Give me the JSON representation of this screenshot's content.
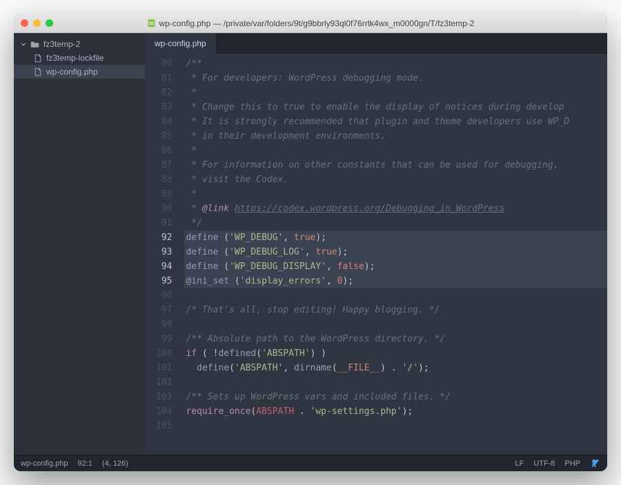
{
  "window": {
    "title": "wp-config.php — /private/var/folders/9t/g9bbrly93ql0f76rrtk4wx_m0000gn/T/fz3temp-2"
  },
  "sidebar": {
    "folder": "fz3temp-2",
    "files": [
      {
        "name": "fz3temp-lockfile",
        "active": false
      },
      {
        "name": "wp-config.php",
        "active": true
      }
    ]
  },
  "tabs": [
    {
      "label": "wp-config.php",
      "active": true
    }
  ],
  "editor": {
    "lines": [
      {
        "n": 80,
        "hl": false,
        "tokens": [
          [
            "c-comment",
            "/**"
          ]
        ]
      },
      {
        "n": 81,
        "hl": false,
        "tokens": [
          [
            "c-comment",
            " * For developers: WordPress debugging mode."
          ]
        ]
      },
      {
        "n": 82,
        "hl": false,
        "tokens": [
          [
            "c-comment",
            " *"
          ]
        ]
      },
      {
        "n": 83,
        "hl": false,
        "tokens": [
          [
            "c-comment",
            " * Change this to true to enable the display of notices during develop"
          ]
        ]
      },
      {
        "n": 84,
        "hl": false,
        "tokens": [
          [
            "c-comment",
            " * It is strongly recommended that plugin and theme developers use WP_D"
          ]
        ]
      },
      {
        "n": 85,
        "hl": false,
        "tokens": [
          [
            "c-comment",
            " * in their development environments."
          ]
        ]
      },
      {
        "n": 86,
        "hl": false,
        "tokens": [
          [
            "c-comment",
            " *"
          ]
        ]
      },
      {
        "n": 87,
        "hl": false,
        "tokens": [
          [
            "c-comment",
            " * For information on other constants that can be used for debugging,"
          ]
        ]
      },
      {
        "n": 88,
        "hl": false,
        "tokens": [
          [
            "c-comment",
            " * visit the Codex."
          ]
        ]
      },
      {
        "n": 89,
        "hl": false,
        "tokens": [
          [
            "c-comment",
            " *"
          ]
        ]
      },
      {
        "n": 90,
        "hl": false,
        "tokens": [
          [
            "c-comment",
            " * "
          ],
          [
            "c-tag",
            "@link"
          ],
          [
            "c-comment",
            " "
          ],
          [
            "c-link",
            "https://codex.wordpress.org/Debugging_in_WordPress"
          ]
        ]
      },
      {
        "n": 91,
        "hl": false,
        "tokens": [
          [
            "c-comment",
            " */"
          ]
        ]
      },
      {
        "n": 92,
        "hl": true,
        "tokens": [
          [
            "c-fn",
            "define"
          ],
          [
            "c-delim",
            " ("
          ],
          [
            "c-str",
            "'WP_DEBUG'"
          ],
          [
            "c-delim",
            ", "
          ],
          [
            "c-const",
            "true"
          ],
          [
            "c-delim",
            ");"
          ]
        ]
      },
      {
        "n": 93,
        "hl": true,
        "tokens": [
          [
            "c-fn",
            "define"
          ],
          [
            "c-delim",
            " ("
          ],
          [
            "c-str",
            "'WP_DEBUG_LOG'"
          ],
          [
            "c-delim",
            ", "
          ],
          [
            "c-const",
            "true"
          ],
          [
            "c-delim",
            ");"
          ]
        ]
      },
      {
        "n": 94,
        "hl": true,
        "tokens": [
          [
            "c-fn",
            "define"
          ],
          [
            "c-delim",
            " ("
          ],
          [
            "c-str",
            "'WP_DEBUG_DISPLAY'"
          ],
          [
            "c-delim",
            ", "
          ],
          [
            "c-const",
            "false"
          ],
          [
            "c-delim",
            ");"
          ]
        ]
      },
      {
        "n": 95,
        "hl": true,
        "tokens": [
          [
            "c-at",
            "@"
          ],
          [
            "c-fn",
            "ini_set"
          ],
          [
            "c-delim",
            " ("
          ],
          [
            "c-str",
            "'display_errors'"
          ],
          [
            "c-delim",
            ", "
          ],
          [
            "c-const",
            "0"
          ],
          [
            "c-delim",
            ");"
          ]
        ]
      },
      {
        "n": 96,
        "hl": false,
        "tokens": [
          [
            "c-delim",
            ""
          ]
        ]
      },
      {
        "n": 97,
        "hl": false,
        "tokens": [
          [
            "c-comment",
            "/* That's all, stop editing! Happy blogging. */"
          ]
        ]
      },
      {
        "n": 98,
        "hl": false,
        "tokens": [
          [
            "c-delim",
            ""
          ]
        ]
      },
      {
        "n": 99,
        "hl": false,
        "tokens": [
          [
            "c-comment",
            "/** Absolute path to the WordPress directory. */"
          ]
        ]
      },
      {
        "n": 100,
        "hl": false,
        "tokens": [
          [
            "c-kw",
            "if"
          ],
          [
            "c-delim",
            " ( !"
          ],
          [
            "c-fn",
            "defined"
          ],
          [
            "c-delim",
            "("
          ],
          [
            "c-str",
            "'ABSPATH'"
          ],
          [
            "c-delim",
            ") )"
          ]
        ]
      },
      {
        "n": 101,
        "hl": false,
        "tokens": [
          [
            "c-delim",
            "  "
          ],
          [
            "c-fn",
            "define"
          ],
          [
            "c-delim",
            "("
          ],
          [
            "c-str",
            "'ABSPATH'"
          ],
          [
            "c-delim",
            ", "
          ],
          [
            "c-fn",
            "dirname"
          ],
          [
            "c-delim",
            "("
          ],
          [
            "c-const",
            "__FILE__"
          ],
          [
            "c-delim",
            ") . "
          ],
          [
            "c-str",
            "'/'"
          ],
          [
            "c-delim",
            ");"
          ]
        ]
      },
      {
        "n": 102,
        "hl": false,
        "tokens": [
          [
            "c-delim",
            ""
          ]
        ]
      },
      {
        "n": 103,
        "hl": false,
        "tokens": [
          [
            "c-comment",
            "/** Sets up WordPress vars and included files. */"
          ]
        ]
      },
      {
        "n": 104,
        "hl": false,
        "tokens": [
          [
            "c-kw",
            "require_once"
          ],
          [
            "c-delim",
            "("
          ],
          [
            "c-var",
            "ABSPATH"
          ],
          [
            "c-delim",
            " . "
          ],
          [
            "c-str",
            "'wp-settings.php'"
          ],
          [
            "c-delim",
            ");"
          ]
        ]
      },
      {
        "n": 105,
        "hl": false,
        "tokens": [
          [
            "c-delim",
            ""
          ]
        ]
      }
    ]
  },
  "statusbar": {
    "file": "wp-config.php",
    "cursor": "92:1",
    "selection": "(4, 126)",
    "eol": "LF",
    "encoding": "UTF-8",
    "lang": "PHP"
  }
}
